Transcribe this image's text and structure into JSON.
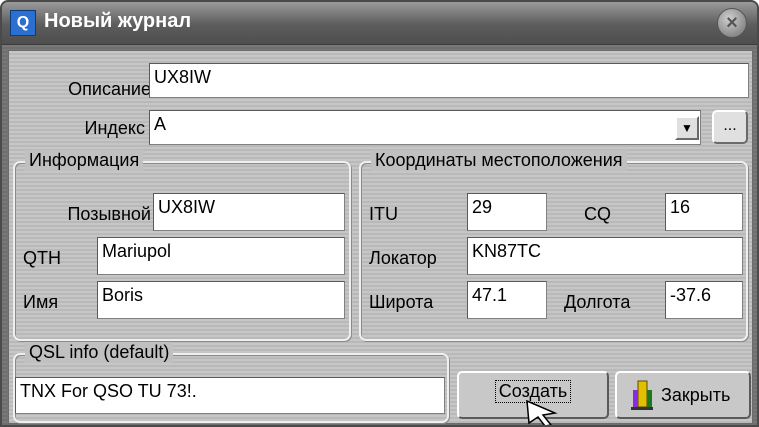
{
  "window": {
    "title": "Новый журнал",
    "icon": "app-logo-icon",
    "close_icon": "close-icon"
  },
  "form": {
    "description_label": "Описание",
    "description_value": "UX8IW",
    "index_label": "Индекс",
    "index_value": "A",
    "browse_label": "..."
  },
  "info": {
    "title": "Информация",
    "callsign_label": "Позывной",
    "callsign_value": "UX8IW",
    "qth_label": "QTH",
    "qth_value": "Mariupol",
    "name_label": "Имя",
    "name_value": "Boris"
  },
  "coords": {
    "title": "Координаты местоположения",
    "itu_label": "ITU",
    "itu_value": "29",
    "cq_label": "CQ",
    "cq_value": "16",
    "locator_label": "Локатор",
    "locator_value": "KN87TC",
    "lat_label": "Широта",
    "lat_value": "47.1",
    "lon_label": "Долгота",
    "lon_value": "-37.6"
  },
  "qsl": {
    "title": "QSL info (default)",
    "value": "TNX For QSO TU 73!."
  },
  "buttons": {
    "create_label": "Создать",
    "close_label": "Закрыть",
    "close_icon": "door-exit-icon"
  },
  "colors": {
    "title_bar": "#5c5c5c",
    "panel": "#c0c0c0",
    "app_icon": "#2b6fd1"
  }
}
